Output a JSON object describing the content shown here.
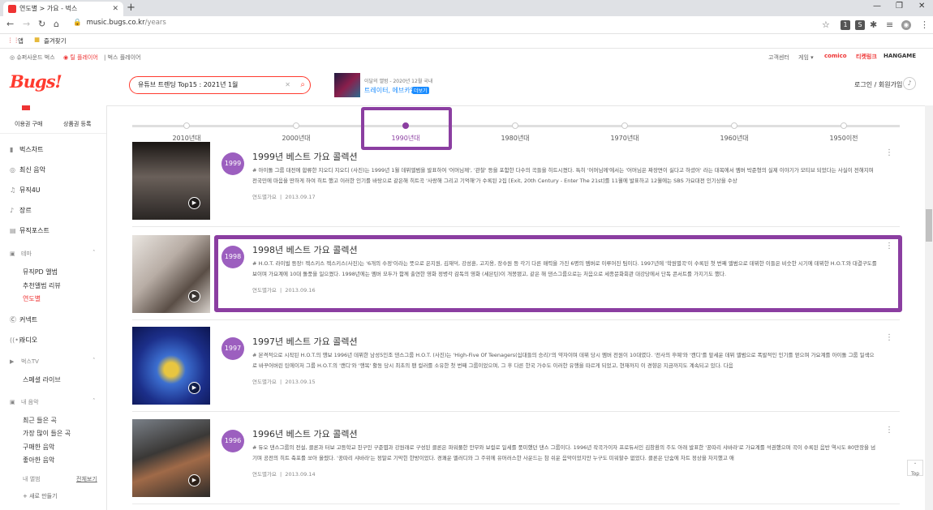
{
  "browser": {
    "tab_title": "연도별 > 가요 - 벅스",
    "url_host": "music.bugs.co.kr",
    "url_path": "/years",
    "bookmarks": [
      "앱",
      "즐겨찾기"
    ]
  },
  "topnav": {
    "left": [
      "슈퍼사운드 벅스",
      "틸 플레이어",
      "벅스 플레이어"
    ],
    "right": [
      "고객센터",
      "게임",
      "comico",
      "티켓링크",
      "HANGAME"
    ]
  },
  "header": {
    "logo": "Bugs!",
    "search_value": "유튜브 트렌딩 Top15 : 2021년 1월",
    "promo_sub": "이달의 앨범 - 2020년 12월 국내",
    "promo_title": "트레이터, 에브카임 외",
    "promo_badge": "더보기",
    "login": "로그인 / 회원가입"
  },
  "sidebar": {
    "buy": "이용권 구매",
    "register": "상품권 등록",
    "items": [
      "벅스차트",
      "최신 음악",
      "뮤직4U",
      "장르",
      "뮤직포스트"
    ],
    "theme_head": "테마",
    "theme_items": [
      "뮤직PD 앨범",
      "추천앨범 리뷰",
      "연도별"
    ],
    "items2": [
      "커넥트",
      "라디오"
    ],
    "bugstv_head": "벅스TV",
    "tv_items": [
      "스페셜 라이브"
    ],
    "my_head": "내 음악",
    "my_items": [
      "최근 들은 곡",
      "가장 많이 들은 곡",
      "구매한 음악",
      "좋아한 음악"
    ],
    "playlist_head": "내 앨범",
    "playlist_all": "전체보기",
    "new_playlist": "+ 새로 만들기"
  },
  "timeline": [
    "2010년대",
    "2000년대",
    "1990년대",
    "1980년대",
    "1970년대",
    "1960년대",
    "1950이전"
  ],
  "cards": [
    {
      "year": "1999",
      "title": "1999년 베스트 가요 콜렉션",
      "desc": "# 아이돌 그룹 대전에 합류한 지오디 지오디 (사진)는 1999년 1월 데뷔앨범을 발표하여 '어머님께', '관찰' 등을 포함한 다수의 곡들을 히트시켰다. 특히 '어머님께'에서는 '어머님은 짜장면이 싫다고 하셨어' 라는 대목에서 멤버 박준형의 실제 이야기가 모티브 되었다는 사실이 전해지며 전국민에 마음을 딴하게 하여 히트 했고 이러한 인기를 바탕으로 같은해 히트곡 '사랑해 그리고 기억해'가 수록된 2집 [Exit, 20th Century - Enter The 21st]를 11월에 발표하고 12월에는 SBS 가요대전 인기상을 수상",
      "cat": "연도별가요",
      "date": "2013.09.17"
    },
    {
      "year": "1998",
      "title": "1998년 베스트 가요 콜렉션",
      "desc": "# H.O.T. 라이벌 등장! 젝스키스 젝스키스(사진)는 '6개의 수정'이라는 뜻으로 은지원, 김재덕, 강성훈, 고지용, 장수원 등 각기 다른 매력을 가진 6명의 멤버로 이루어진 팀이다. 1997년에 '학원별곡'이 수록된 첫 번째 앨범으로 데뷔한 이들은 비슷한 시기에 데뷔한 H.O.T.와 대결구도를 보이며 가요계에 10대 돌풍을 일으켰다. 1998년에는 멤버 모두가 함께 출연한 영화 정병각 감독의 영화 (세븐틴)이 개봉됐고, 같은 해 댄스그룹으로는 처음으로 세종문화회관 대강당에서 단독 콘서트를 가지기도 했다.",
      "cat": "연도별가요",
      "date": "2013.09.16"
    },
    {
      "year": "1997",
      "title": "1997년 베스트 가요 콜렉션",
      "desc": "# 본격적으로 시작된 H.O.T.의 행보 1996년 데뷔한 남성5인조 댄스그룹 H.O.T. (사진)는 'High-Five Of Teenagers(십대들의 승리)'의 약자이며 데뷔 당시 멤버 전원이 10대였다. '전사의 후예'와 '캔디'를 앞세운 데뷔 앨범으로 폭발적인 인기를 얻으며 가요계를 아이돌 그룹 일색으로 바꾸어버린 틴에이저 그룹 H.O.T.의 '캔디'와 '행복' 활동 당시 최초의 팬 컬러를 소유한 첫 번째 그룹이었으며, 그 후 다른 한국 가수도 이러한 유행을 따르게 되었고, 현재까지 이 경향은 지금까지도 계속되고 있다. 다음",
      "cat": "연도별가요",
      "date": "2013.09.15"
    },
    {
      "year": "1996",
      "title": "1996년 베스트 가요 콜렉션",
      "desc": "# 듀오 댄스그룹의 전설, 클론과 터보 고등학교 친구인 구준엽과 강원래로 구성된 클론은 파워풀한 안무와 보컬로 일세를 풍미했던 댄스 그룹이다. 1996년 작곡가이자 프로듀서인 김창환의 주도 아래 발표한 '꿍따리 샤바라'로 가요계를 석권했으며 곡이 수록된 음반 역시도 80만장을 넘기며 공전의 히트 축포를 쏘아 올렸다. '꿍따리 샤바라'는 정말로 기막힌 한방이었다. 경쾌운 멜러디와 그 주위에 유머러스한 사운드는 참 쉬운 음악이었지만 누구도 미워할수 없었다. 클론은 단숨에 차트 정상을 차지했고 애",
      "cat": "연도별가요",
      "date": "2013.09.14"
    }
  ],
  "top_button": "Top"
}
